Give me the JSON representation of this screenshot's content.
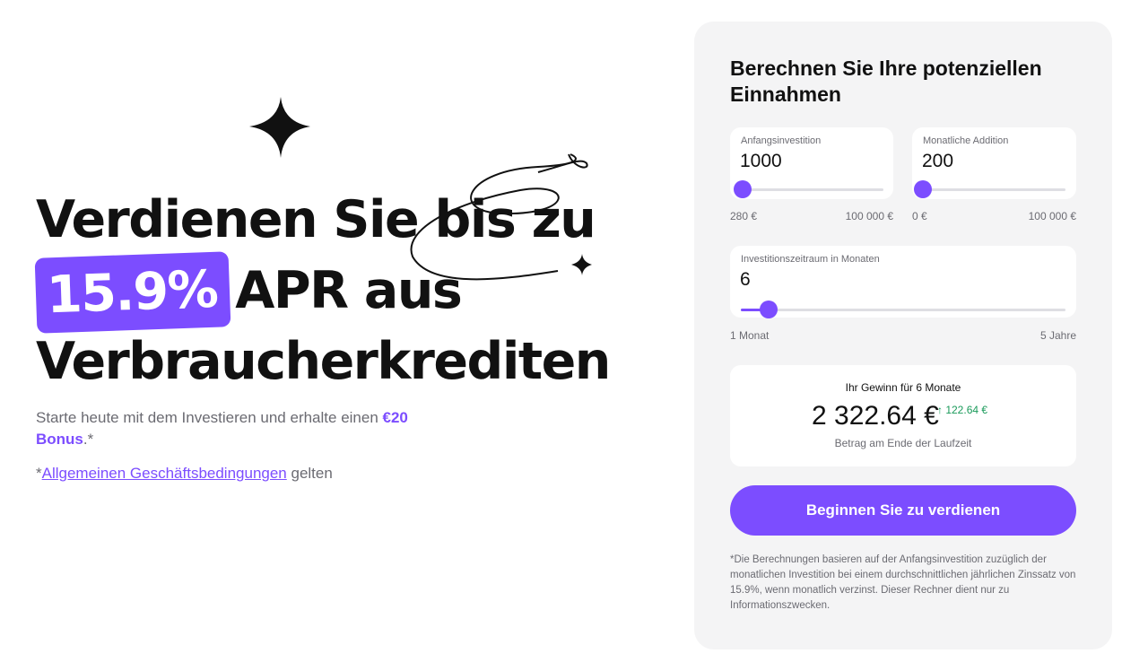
{
  "hero": {
    "headline_line1": "Verdienen Sie bis zu",
    "badge": "15.9%",
    "headline_line2": "APR aus",
    "headline_line3": "Verbraucherkrediten",
    "subtext_prefix": "Starte heute mit dem Investieren und erhalte einen ",
    "bonus": "€20 Bonus",
    "subtext_suffix": ".*",
    "terms_prefix": "*",
    "terms_link": "Allgemeinen Geschäftsbedingungen",
    "terms_suffix": " gelten"
  },
  "decorations": [
    "sparkle-icon",
    "sparkle-icon",
    "swirl-line"
  ],
  "calculator": {
    "title": "Berechnen Sie Ihre potenziellen Einnahmen",
    "initial": {
      "label": "Anfangsinvestition",
      "value": "1000",
      "min_label": "280 €",
      "max_label": "100 000 €",
      "level": 0.01
    },
    "monthly": {
      "label": "Monatliche Addition",
      "value": "200",
      "min_label": "0 €",
      "max_label": "100 000 €",
      "level": 0.0
    },
    "period": {
      "label": "Investitionszeitraum in Monaten",
      "value": "6",
      "min_label": "1 Monat",
      "max_label": "5 Jahre",
      "level": 0.085
    },
    "result": {
      "title": "Ihr Gewinn für 6 Monate",
      "amount": "2 322.64 €",
      "gain": "↑ 122.64 €",
      "note": "Betrag am Ende der Laufzeit"
    },
    "cta": "Beginnen Sie zu verdienen",
    "disclaimer": "*Die Berechnungen basieren auf der Anfangsinvestition zuzüglich der monatlichen Investition bei einem durchschnittlichen jährlichen Zinssatz von 15.9%, wenn monatlich verzinst. Dieser Rechner dient nur zu Informationszwecken."
  },
  "colors": {
    "accent": "#7c4dff",
    "gain": "#1a9a5a",
    "muted": "#6b6b72",
    "panel": "#f4f4f5"
  }
}
